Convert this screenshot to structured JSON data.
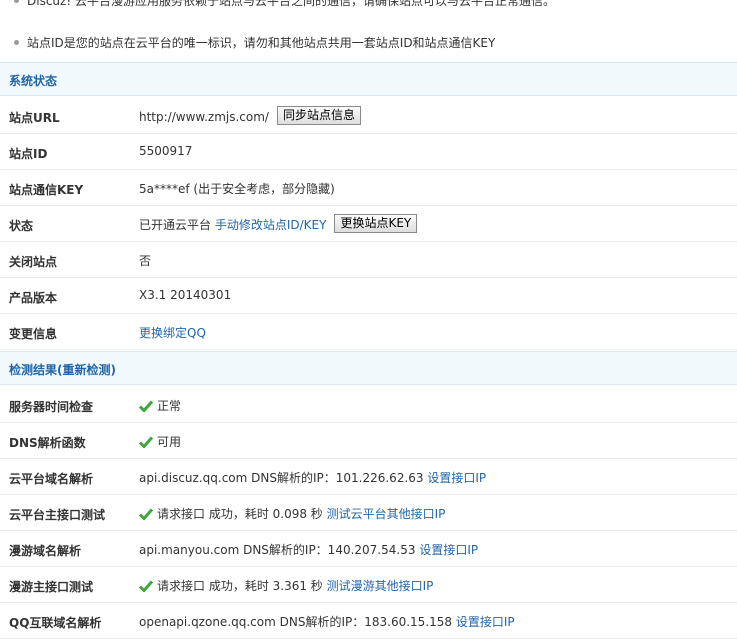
{
  "notice": {
    "line1": "Discuz! 云平台漫游应用服务依赖于站点与云平台之间的通信，请确保站点可以与云平台正常通信。",
    "line2": "站点ID是您的站点在云平台的唯一标识，请勿和其他站点共用一套站点ID和站点通信KEY"
  },
  "system_status": {
    "title": "系统状态",
    "rows": {
      "site_url": {
        "label": "站点URL",
        "value": "http://www.zmjs.com/",
        "button": "同步站点信息"
      },
      "site_id": {
        "label": "站点ID",
        "value": "5500917"
      },
      "site_key": {
        "label": "站点通信KEY",
        "value": "5a****ef (出于安全考虑，部分隐藏)"
      },
      "status": {
        "label": "状态",
        "value": "已开通云平台",
        "link": "手动修改站点ID/KEY",
        "button": "更换站点KEY"
      },
      "close_site": {
        "label": "关闭站点",
        "value": "否"
      },
      "version": {
        "label": "产品版本",
        "value": "X3.1 20140301"
      },
      "change_info": {
        "label": "变更信息",
        "link": "更换绑定QQ"
      }
    }
  },
  "check_results": {
    "title": "检测结果(",
    "recheck": "重新检测",
    "title_end": ")",
    "rows": {
      "server_time": {
        "label": "服务器时间检查",
        "value": "正常"
      },
      "dns_func": {
        "label": "DNS解析函数",
        "value": "可用"
      },
      "cloud_dns": {
        "label": "云平台域名解析",
        "value": "api.discuz.qq.com DNS解析的IP：101.226.62.63",
        "link": "设置接口IP"
      },
      "cloud_api": {
        "label": "云平台主接口测试",
        "value": "请求接口 成功，耗时 0.098 秒",
        "link": "测试云平台其他接口IP"
      },
      "manyou_dns": {
        "label": "漫游域名解析",
        "value": "api.manyou.com DNS解析的IP：140.207.54.53",
        "link": "设置接口IP"
      },
      "manyou_api": {
        "label": "漫游主接口测试",
        "value": "请求接口 成功，耗时 3.361 秒",
        "link": "测试漫游其他接口IP"
      },
      "qq_dns": {
        "label": "QQ互联域名解析",
        "value": "openapi.qzone.qq.com DNS解析的IP：183.60.15.158",
        "link": "设置接口IP"
      }
    }
  },
  "colors": {
    "link": "#2366a8",
    "section_bg": "#f2f9fd",
    "check": "#3aa83a"
  },
  "icons": {
    "check": "check-icon",
    "bullet": "bullet-icon"
  }
}
